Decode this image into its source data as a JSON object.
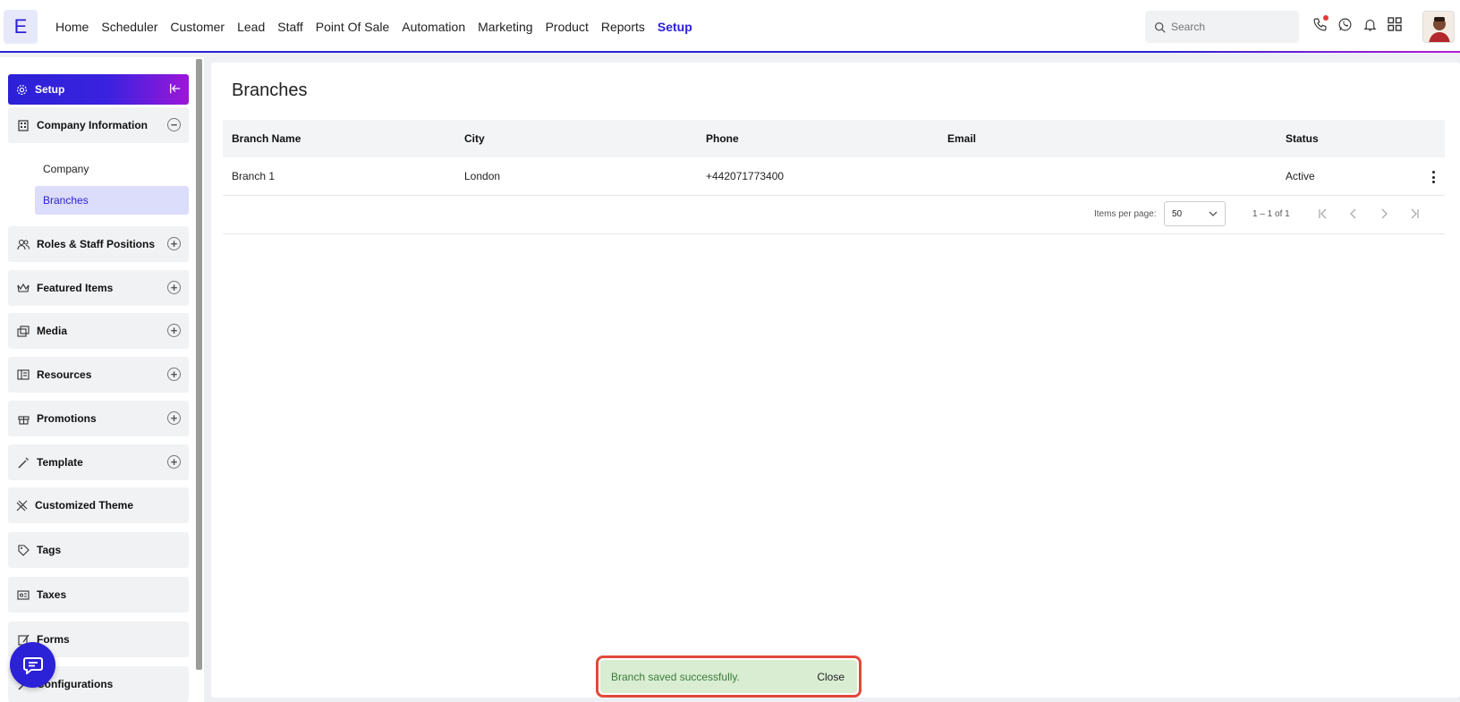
{
  "topbar": {
    "logo": "E",
    "nav": [
      "Home",
      "Scheduler",
      "Customer",
      "Lead",
      "Staff",
      "Point Of Sale",
      "Automation",
      "Marketing",
      "Product",
      "Reports",
      "Setup"
    ],
    "active_nav": "Setup",
    "search_placeholder": "Search",
    "icons": [
      "phone-icon",
      "whatsapp-icon",
      "bell-icon",
      "apps-grid-icon"
    ]
  },
  "sidebar": {
    "header": "Setup",
    "groups": [
      {
        "label": "Company Information",
        "icon": "building-icon",
        "expanded": true
      },
      {
        "label": "Roles & Staff Positions",
        "icon": "users-icon",
        "expanded": false
      },
      {
        "label": "Featured Items",
        "icon": "crown-icon",
        "expanded": false
      },
      {
        "label": "Media",
        "icon": "media-icon",
        "expanded": false
      },
      {
        "label": "Resources",
        "icon": "resources-icon",
        "expanded": false
      },
      {
        "label": "Promotions",
        "icon": "gift-icon",
        "expanded": false
      },
      {
        "label": "Template",
        "icon": "magic-wand-icon",
        "expanded": false
      },
      {
        "label": "Customized Theme",
        "icon": "theme-icon"
      },
      {
        "label": "Tags",
        "icon": "tag-icon"
      },
      {
        "label": "Taxes",
        "icon": "tax-icon"
      },
      {
        "label": "Forms",
        "icon": "form-icon"
      },
      {
        "label": "Configurations",
        "icon": "config-icon"
      }
    ],
    "subitems": [
      {
        "label": "Company",
        "active": false
      },
      {
        "label": "Branches",
        "active": true
      }
    ]
  },
  "main": {
    "title": "Branches",
    "table": {
      "headers": [
        "Branch Name",
        "City",
        "Phone",
        "Email",
        "Status"
      ],
      "rows": [
        {
          "name": "Branch 1",
          "city": "London",
          "phone": "+442071773400",
          "email": "",
          "status": "Active"
        }
      ]
    },
    "paginator": {
      "items_per_page_label": "Items per page:",
      "items_per_page": "50",
      "range": "1 – 1 of 1"
    }
  },
  "snackbar": {
    "message": "Branch saved successfully.",
    "action": "Close"
  },
  "colors": {
    "brand": "#2b21d6",
    "accent_gradient_end": "#9c16d8",
    "snackbar_bg": "#d9edd3",
    "snackbar_text": "#3d7b3a",
    "highlight_border": "#e04a3a"
  }
}
